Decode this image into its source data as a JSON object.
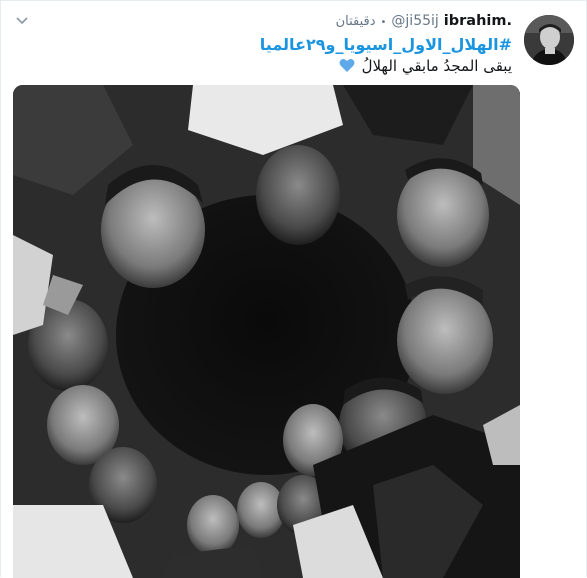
{
  "tweet": {
    "display_name": "ibrahim.",
    "screen_name": "@ji55ij",
    "timestamp": "دقيقتان",
    "hashtag": "#الهلال_الاول_اسيويا_و٢٩عالميا",
    "text": "يبقى المجدُ مابقي الهلالُ",
    "emoji": "💙"
  },
  "icons": {
    "menu": "chevron-down-icon",
    "avatar": "avatar-photo",
    "media": "team-huddle-photo"
  },
  "colors": {
    "link": "#1b95e0",
    "secondary_text": "#657786",
    "primary_text": "#14171a",
    "heart": "#5da9e9"
  }
}
